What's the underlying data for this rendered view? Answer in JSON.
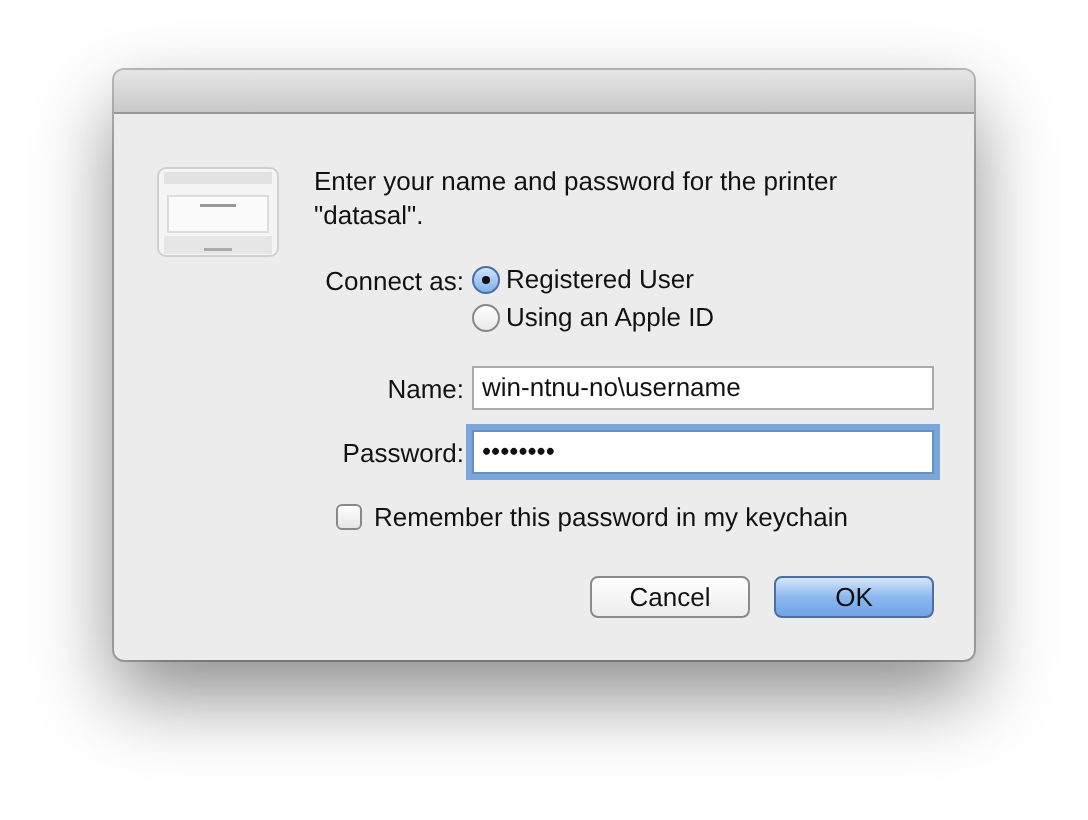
{
  "message": "Enter your name and password for the printer \"datasal\".",
  "connect_as": {
    "label": "Connect as:",
    "options": [
      {
        "label": "Registered User",
        "selected": true
      },
      {
        "label": "Using an Apple ID",
        "selected": false
      }
    ]
  },
  "fields": [
    {
      "label": "Name:",
      "value": "win-ntnu-no\\username",
      "focused": false
    },
    {
      "label": "Password:",
      "value": "••••••••",
      "focused": true
    }
  ],
  "remember": {
    "label": "Remember this password in my keychain",
    "checked": false
  },
  "buttons": [
    {
      "label": "Cancel",
      "default": false
    },
    {
      "label": "OK",
      "default": true
    }
  ]
}
